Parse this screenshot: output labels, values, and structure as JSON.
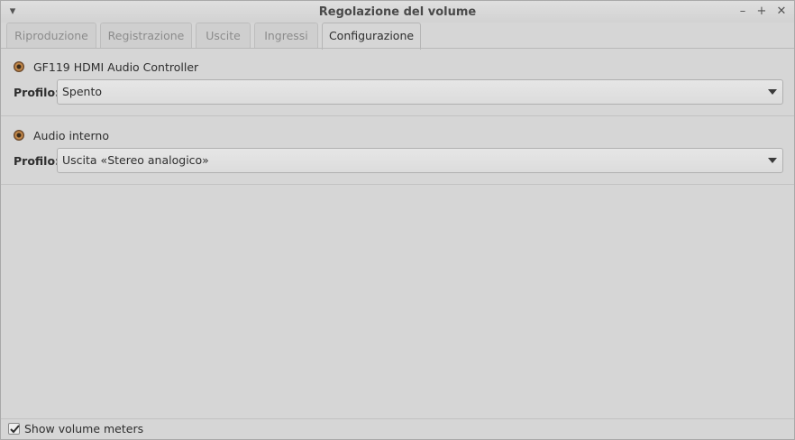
{
  "window": {
    "title": "Regolazione del volume",
    "menu_icon": "chevron-down-icon",
    "controls": {
      "minimize": "–",
      "maximize": "+",
      "close": "✕"
    }
  },
  "tabs": [
    {
      "label": "Riproduzione",
      "active": false
    },
    {
      "label": "Registrazione",
      "active": false
    },
    {
      "label": "Uscite",
      "active": false
    },
    {
      "label": "Ingressi",
      "active": false
    },
    {
      "label": "Configurazione",
      "active": true
    }
  ],
  "cards": [
    {
      "name": "GF119 HDMI Audio Controller",
      "icon": "audio-card-icon",
      "profile_label": "Profilo:",
      "profile_value": "Spento"
    },
    {
      "name": "Audio interno",
      "icon": "audio-card-icon",
      "profile_label": "Profilo:",
      "profile_value": "Uscita «Stereo analogico»"
    }
  ],
  "footer": {
    "show_meters_label": "Show volume meters",
    "show_meters_checked": true
  },
  "colors": {
    "background": "#d6d6d6",
    "active_tab_text": "#2e2e2e",
    "inactive_tab_text": "#8c8c8c"
  }
}
